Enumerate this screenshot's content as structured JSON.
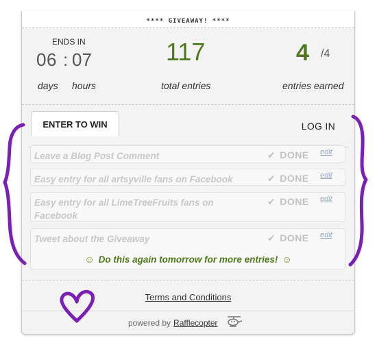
{
  "header": {
    "title": "**** GIVEAWAY! ****"
  },
  "stats": {
    "ends_label": "ENDS IN",
    "countdown_days": "06",
    "countdown_sep": ":",
    "countdown_hours": "07",
    "days_unit": "days",
    "hours_unit": "hours",
    "total_entries": "117",
    "total_label": "total entries",
    "earned_value": "4",
    "earned_total": "/4",
    "earned_label": "entries earned"
  },
  "tabs": {
    "enter": "ENTER TO WIN",
    "login": "LOG IN"
  },
  "entries": [
    {
      "label": "Leave a Blog Post Comment",
      "status": "DONE",
      "edit": "edit"
    },
    {
      "label": "Easy entry for all artsyville fans on Facebook",
      "status": "DONE",
      "edit": "edit"
    },
    {
      "label": "Easy entry for all LimeTreeFruits fans on Facebook",
      "status": "DONE",
      "edit": "edit"
    },
    {
      "label": "Tweet about the Giveaway",
      "status": "DONE",
      "edit": "edit"
    }
  ],
  "again_text": "Do this again tomorrow for more entries!",
  "footer": {
    "terms": "Terms and Conditions",
    "powered_by": "powered by",
    "brand": "Rafflecopter"
  },
  "colors": {
    "accent_green": "#4e7a1b",
    "annotation_purple": "#7b1fb5"
  },
  "icons": [
    "check-icon",
    "smile-icon",
    "helicopter-icon",
    "heart-icon",
    "curly-brace-icon"
  ]
}
